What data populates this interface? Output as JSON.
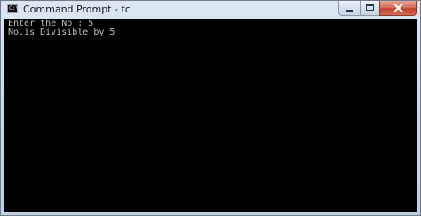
{
  "window": {
    "icon_text": "C:\\",
    "title": "Command Prompt - tc"
  },
  "console": {
    "lines": [
      "Enter the No : 5",
      "No.is Divisible by 5"
    ]
  },
  "caption_buttons": {
    "minimize_icon": "minimize-icon",
    "maximize_icon": "maximize-icon",
    "close_icon": "close-icon"
  }
}
